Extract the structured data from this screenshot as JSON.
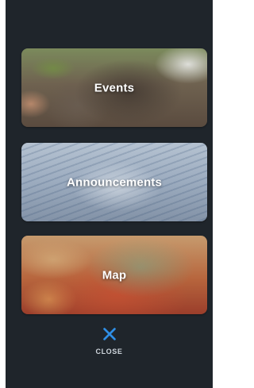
{
  "colors": {
    "background": "#1f252b",
    "close_icon": "#2f8fe6",
    "card_label_text": "#ffffff",
    "close_text": "#cfd6dd"
  },
  "menu": {
    "items": [
      {
        "label": "Events",
        "image": "elephants-photo"
      },
      {
        "label": "Announcements",
        "image": "newspapers-photo"
      },
      {
        "label": "Map",
        "image": "globe-photo"
      }
    ],
    "close": {
      "label": "CLOSE",
      "icon": "close-x-icon"
    }
  }
}
